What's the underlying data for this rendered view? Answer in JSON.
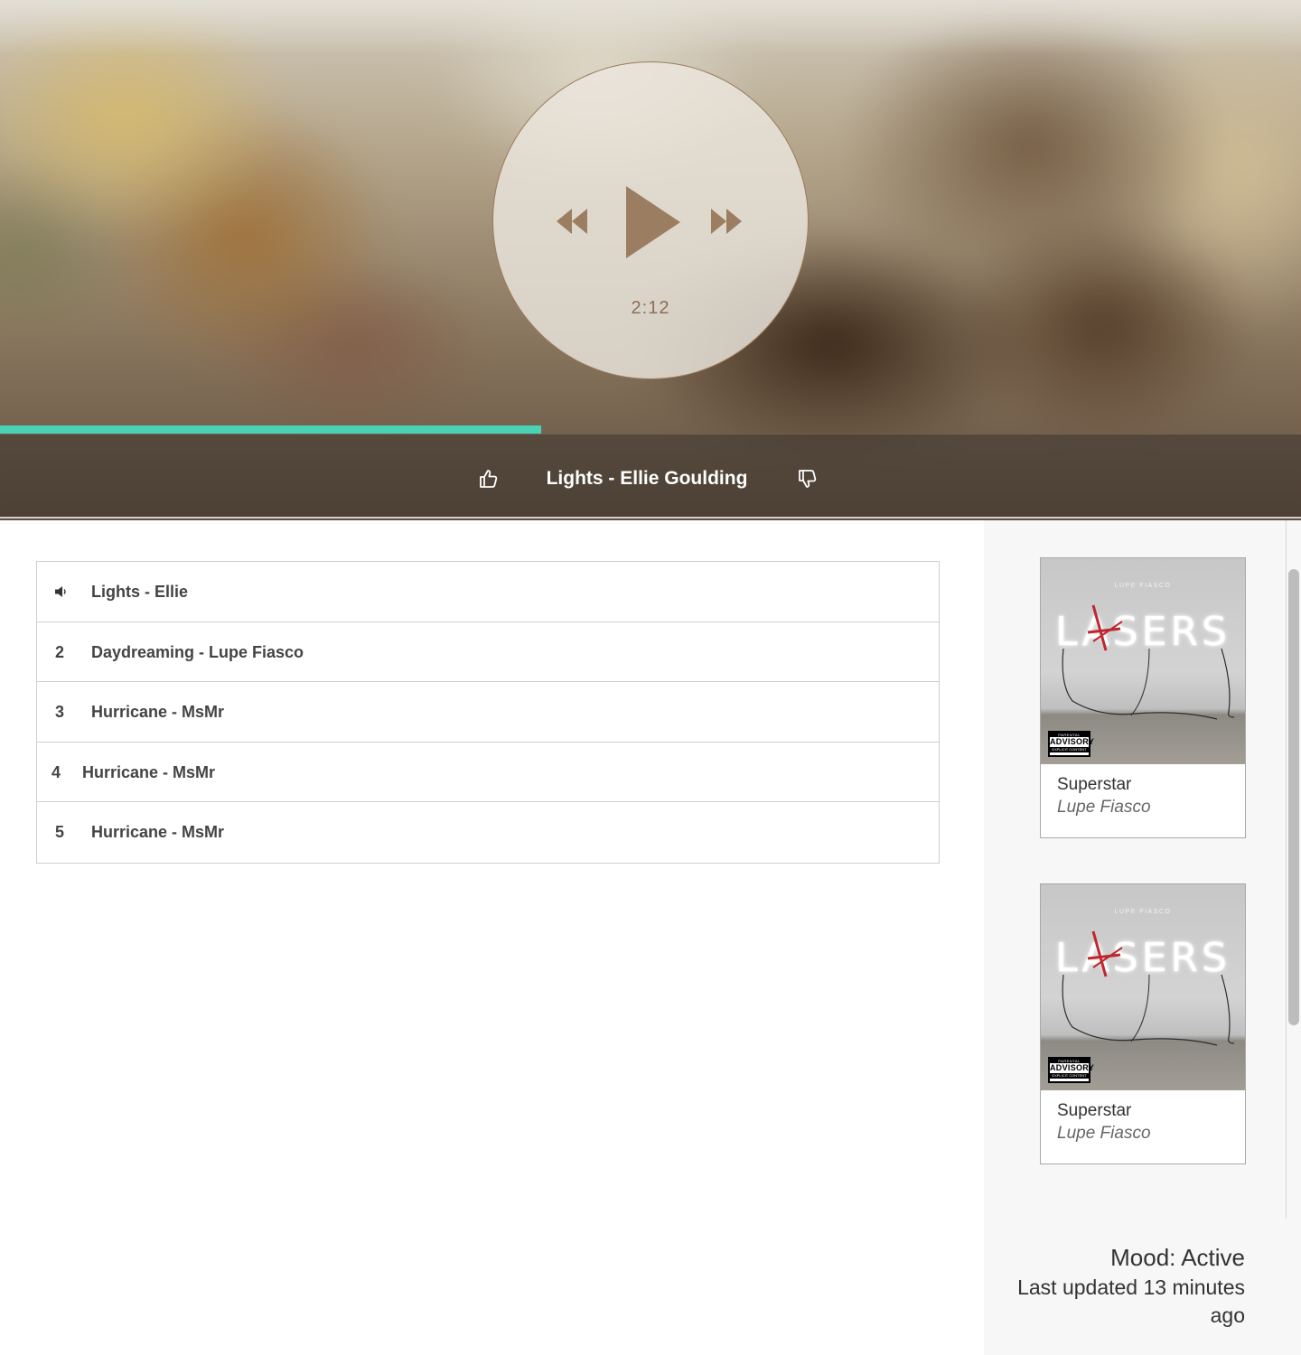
{
  "player": {
    "time": "2:12",
    "progress_fraction": 0.416,
    "accent_color": "#49d2b3",
    "now_playing": "Lights - Ellie Goulding",
    "icons": {
      "prev": "rewind-icon",
      "play": "play-icon",
      "next": "fast-forward-icon",
      "like": "thumbs-up-icon",
      "dislike": "thumbs-down-icon"
    }
  },
  "playlist": {
    "tracks": [
      {
        "num": "",
        "title": "Lights - Ellie",
        "playing": true,
        "icon": "speaker-icon"
      },
      {
        "num": "2",
        "title": "Daydreaming - Lupe Fiasco",
        "playing": false
      },
      {
        "num": "3",
        "title": "Hurricane - MsMr",
        "playing": false
      },
      {
        "num": "4",
        "title": "Hurricane - MsMr",
        "playing": false
      },
      {
        "num": "5",
        "title": "Hurricane - MsMr",
        "playing": false
      }
    ]
  },
  "recommendations": [
    {
      "title": "Superstar",
      "artist": "Lupe Fiasco",
      "cover": {
        "artist_text": "LUPE FIASCO",
        "album_text": "LASERS",
        "advisory_top": "PARENTAL",
        "advisory_mid": "ADVISORY",
        "advisory_bottom": "EXPLICIT CONTENT"
      }
    },
    {
      "title": "Superstar",
      "artist": "Lupe Fiasco",
      "cover": {
        "artist_text": "LUPE FIASCO",
        "album_text": "LASERS",
        "advisory_top": "PARENTAL",
        "advisory_mid": "ADVISORY",
        "advisory_bottom": "EXPLICIT CONTENT"
      }
    }
  ],
  "status": {
    "mood": "Mood: Active",
    "updated": "Last updated 13 minutes ago"
  }
}
